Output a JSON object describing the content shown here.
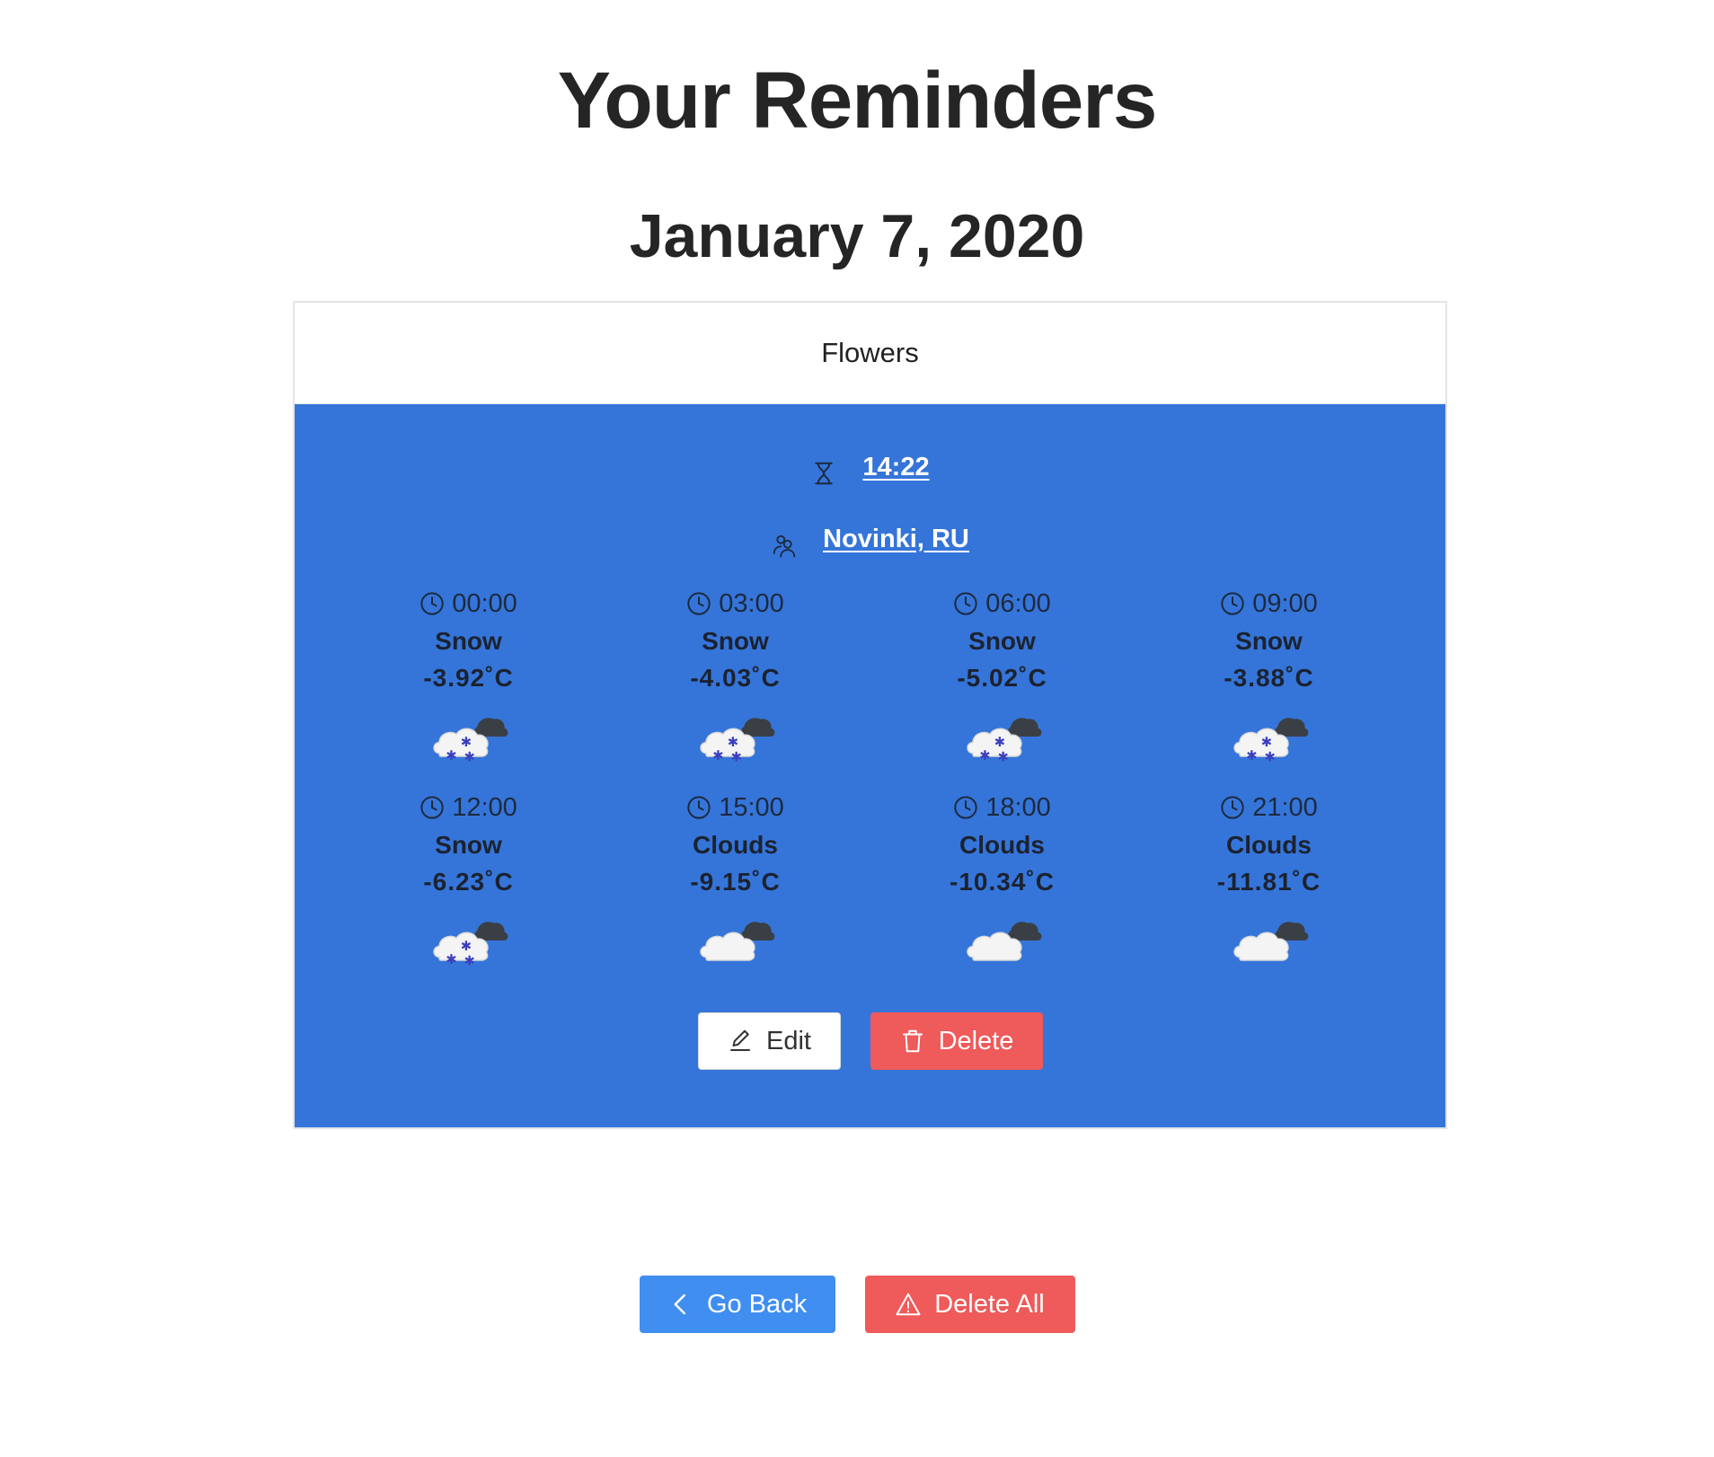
{
  "page": {
    "title": "Your Reminders"
  },
  "day": {
    "date": "January 7, 2020"
  },
  "reminder": {
    "name": "Flowers",
    "time": "14:22",
    "location": "Novinki, RU",
    "card_color": "#3575d9",
    "forecast": [
      {
        "time": "00:00",
        "condition": "Snow",
        "temp": "-3.92˚C",
        "icon": "snow-cloud-icon"
      },
      {
        "time": "03:00",
        "condition": "Snow",
        "temp": "-4.03˚C",
        "icon": "snow-cloud-icon"
      },
      {
        "time": "06:00",
        "condition": "Snow",
        "temp": "-5.02˚C",
        "icon": "snow-cloud-icon"
      },
      {
        "time": "09:00",
        "condition": "Snow",
        "temp": "-3.88˚C",
        "icon": "snow-cloud-icon"
      },
      {
        "time": "12:00",
        "condition": "Snow",
        "temp": "-6.23˚C",
        "icon": "snow-cloud-icon"
      },
      {
        "time": "15:00",
        "condition": "Clouds",
        "temp": "-9.15˚C",
        "icon": "cloud-icon"
      },
      {
        "time": "18:00",
        "condition": "Clouds",
        "temp": "-10.34˚C",
        "icon": "cloud-icon"
      },
      {
        "time": "21:00",
        "condition": "Clouds",
        "temp": "-11.81˚C",
        "icon": "cloud-icon"
      }
    ],
    "actions": {
      "edit_label": "Edit",
      "delete_label": "Delete"
    }
  },
  "footer": {
    "back_label": "Go Back",
    "delete_all_label": "Delete All",
    "primary_color": "#3f8ef0",
    "danger_color": "#ef5a5a"
  }
}
